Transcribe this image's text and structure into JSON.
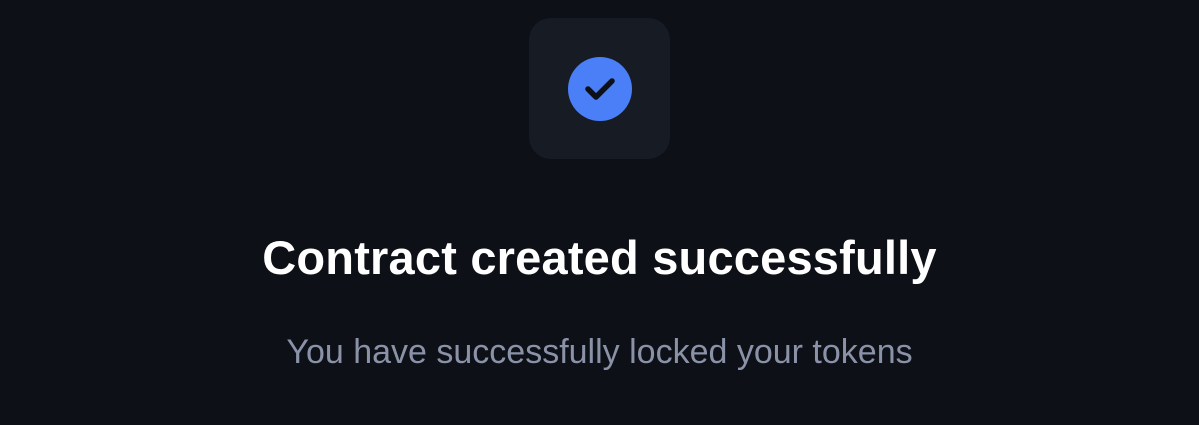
{
  "status_icon": {
    "name": "check-circle-icon",
    "tile_color": "#171b24",
    "circle_color": "#4a7ff7",
    "check_color": "#0d1016"
  },
  "message": {
    "title": "Contract created successfully",
    "subtitle": "You have successfully locked your tokens"
  },
  "colors": {
    "background": "#0d1016",
    "title": "#ffffff",
    "subtitle": "#8a92a8"
  }
}
